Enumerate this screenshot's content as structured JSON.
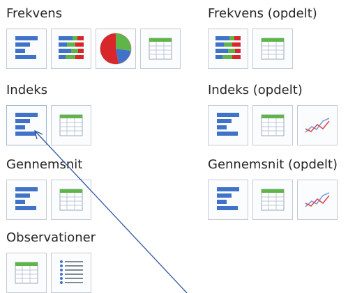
{
  "groups": [
    {
      "key": "frekvens",
      "label": "Frekvens",
      "tiles": [
        {
          "name": "horizontal-bar-chart-icon",
          "icon": "bar"
        },
        {
          "name": "stacked-bar-chart-icon",
          "icon": "stacked"
        },
        {
          "name": "pie-chart-icon",
          "icon": "pie"
        },
        {
          "name": "table-icon",
          "icon": "table"
        }
      ]
    },
    {
      "key": "frekvens-opdelt",
      "label": "Frekvens (opdelt)",
      "tiles": [
        {
          "name": "stacked-bar-chart-icon",
          "icon": "stacked"
        },
        {
          "name": "table-icon",
          "icon": "table"
        }
      ]
    },
    {
      "key": "indeks",
      "label": "Indeks",
      "tiles": [
        {
          "name": "horizontal-bar-chart-icon",
          "icon": "bar",
          "active": true
        },
        {
          "name": "table-icon",
          "icon": "table"
        }
      ]
    },
    {
      "key": "indeks-opdelt",
      "label": "Indeks (opdelt)",
      "tiles": [
        {
          "name": "horizontal-bar-chart-icon",
          "icon": "bar"
        },
        {
          "name": "table-icon",
          "icon": "table"
        },
        {
          "name": "line-chart-icon",
          "icon": "line"
        }
      ]
    },
    {
      "key": "gennemsnit",
      "label": "Gennemsnit",
      "tiles": [
        {
          "name": "horizontal-bar-chart-icon",
          "icon": "bar"
        },
        {
          "name": "table-icon",
          "icon": "table"
        }
      ]
    },
    {
      "key": "gennemsnit-opdelt",
      "label": "Gennemsnit (opdelt)",
      "tiles": [
        {
          "name": "horizontal-bar-chart-icon",
          "icon": "bar"
        },
        {
          "name": "table-icon",
          "icon": "table"
        },
        {
          "name": "line-chart-icon",
          "icon": "line"
        }
      ]
    },
    {
      "key": "observationer",
      "label": "Observationer",
      "tiles": [
        {
          "name": "table-icon",
          "icon": "table"
        },
        {
          "name": "bulleted-list-icon",
          "icon": "list"
        }
      ]
    }
  ],
  "colors": {
    "bar_blue": "#3f72c8",
    "accent_green": "#5fb548",
    "accent_red": "#d9262b",
    "pointer_line": "#2e55a3"
  }
}
